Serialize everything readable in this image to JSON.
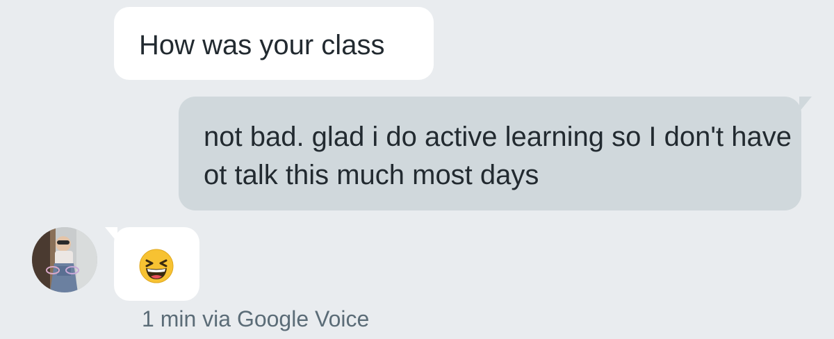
{
  "conversation": {
    "messages": [
      {
        "direction": "incoming",
        "text": "How was your class"
      },
      {
        "direction": "outgoing",
        "text": "not bad. glad i do active learning so I don't have ot talk this much most days"
      },
      {
        "direction": "incoming",
        "emoji": "laughing-face-icon"
      }
    ],
    "meta": "1 min via Google Voice"
  },
  "colors": {
    "background": "#e9ecef",
    "incoming_bubble": "#ffffff",
    "outgoing_bubble": "#d0d8dc",
    "text": "#222a30",
    "meta_text": "#5b6c77"
  }
}
